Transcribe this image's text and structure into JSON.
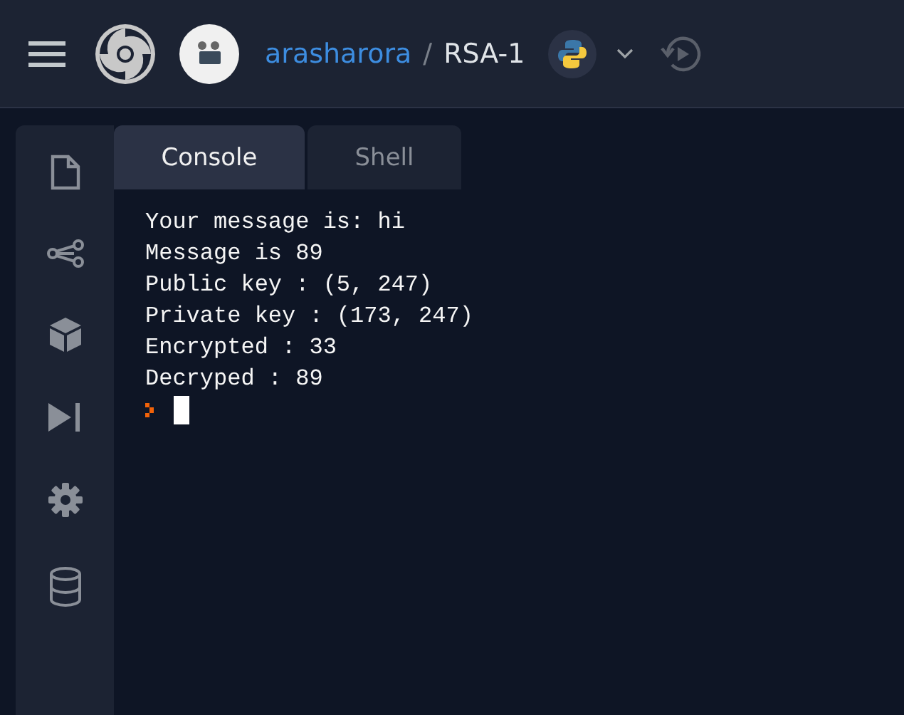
{
  "header": {
    "owner": "arasharora",
    "separator": "/",
    "repl_name": "RSA-1"
  },
  "sidebar": {
    "items": [
      {
        "kind": "file"
      },
      {
        "kind": "share"
      },
      {
        "kind": "cube"
      },
      {
        "kind": "step"
      },
      {
        "kind": "gear"
      },
      {
        "kind": "database"
      }
    ]
  },
  "tabs": [
    {
      "label": "Console",
      "selected": true
    },
    {
      "label": "Shell",
      "selected": false
    }
  ],
  "console": {
    "lines": [
      "Your message is: hi",
      "Message is 89",
      "Public key : (5, 247)",
      "Private key : (173, 247)",
      "Encrypted : 33",
      "Decryped : 89"
    ]
  }
}
